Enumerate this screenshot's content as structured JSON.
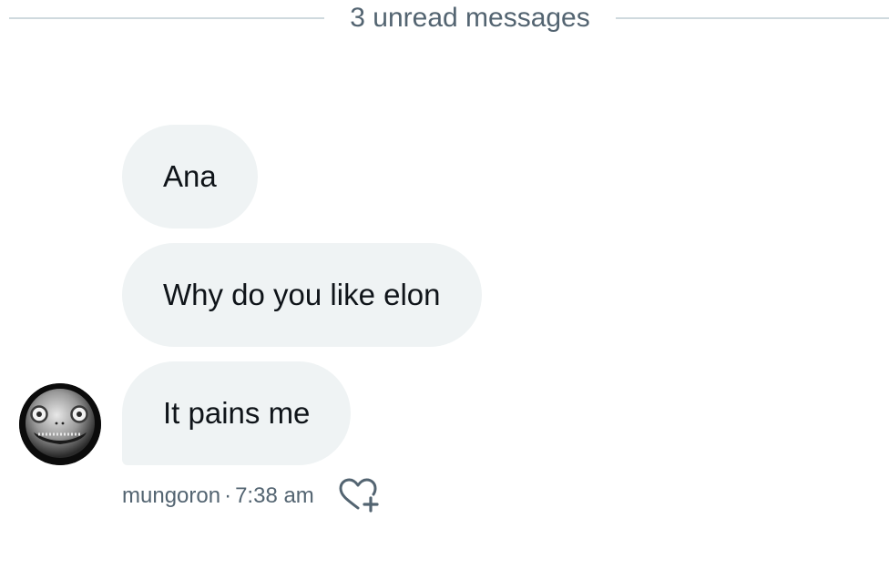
{
  "divider": {
    "label": "3 unread messages"
  },
  "messages": [
    {
      "text": "Ana"
    },
    {
      "text": "Why do you like elon"
    },
    {
      "text": "It pains me"
    }
  ],
  "meta": {
    "sender": "mungoron",
    "separator": "·",
    "time": "7:38 am"
  },
  "icons": {
    "avatar": "emil-mask-avatar",
    "reaction": "heart-plus-icon"
  },
  "colors": {
    "bubble_bg": "#eff3f4",
    "secondary_text": "#536471",
    "divider_line": "#cfd9de",
    "primary_text": "#0f1419"
  }
}
